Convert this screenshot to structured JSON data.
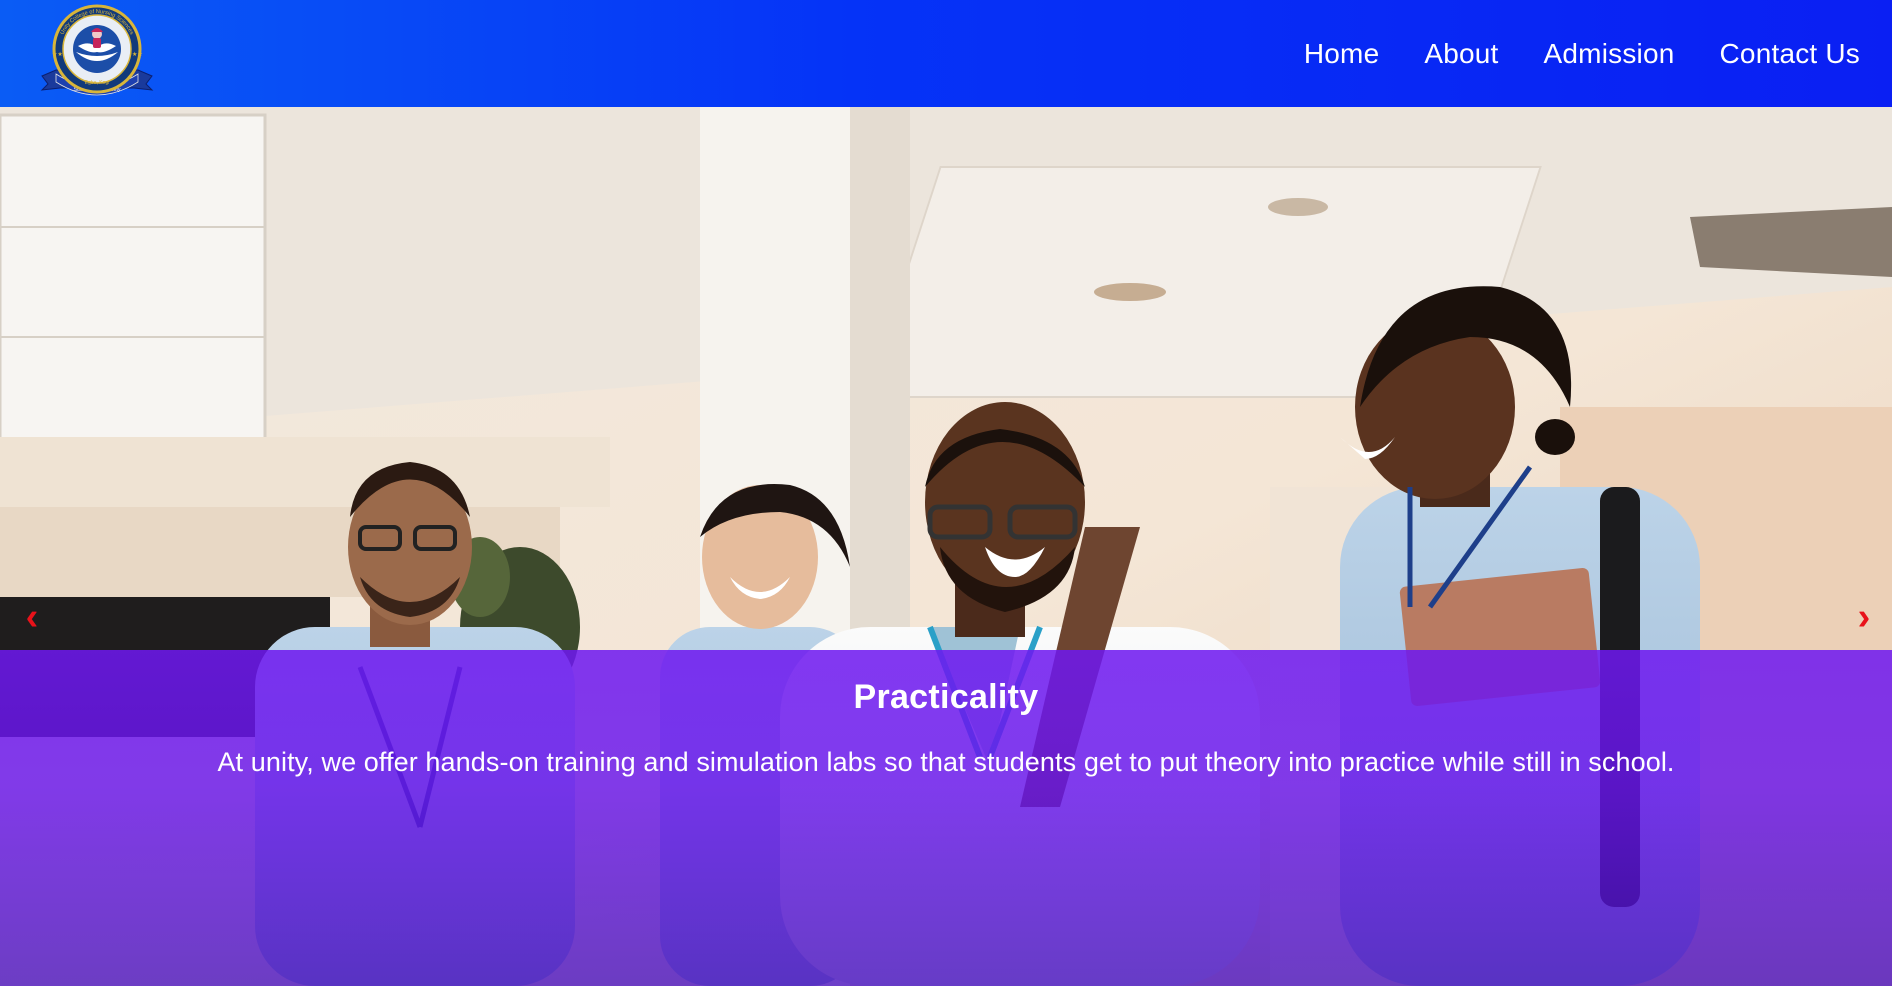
{
  "header": {
    "logo": {
      "ring_text_top": "Unity College of Nursing Sciences",
      "ring_text_bottom": "Egbe, Kogi",
      "motto": "Science is Humanity",
      "icon": "nurse-emblem-icon"
    },
    "nav": [
      {
        "label": "Home"
      },
      {
        "label": "About"
      },
      {
        "label": "Admission"
      },
      {
        "label": "Contact Us"
      }
    ]
  },
  "hero": {
    "image_icon": "nursing-students-photo",
    "prev_icon": "chevron-left-icon",
    "next_icon": "chevron-right-icon",
    "prev_glyph": "‹",
    "next_glyph": "›",
    "slide": {
      "title": "Practicality",
      "text": "At unity, we offer hands-on training and simulation labs so that students get to put theory into practice while still in school."
    }
  },
  "colors": {
    "navbar_start": "#0a5cf5",
    "navbar_end": "#0a1ff3",
    "caption_overlay": "#6e18f0",
    "arrow": "#e8121a",
    "text": "#ffffff"
  }
}
